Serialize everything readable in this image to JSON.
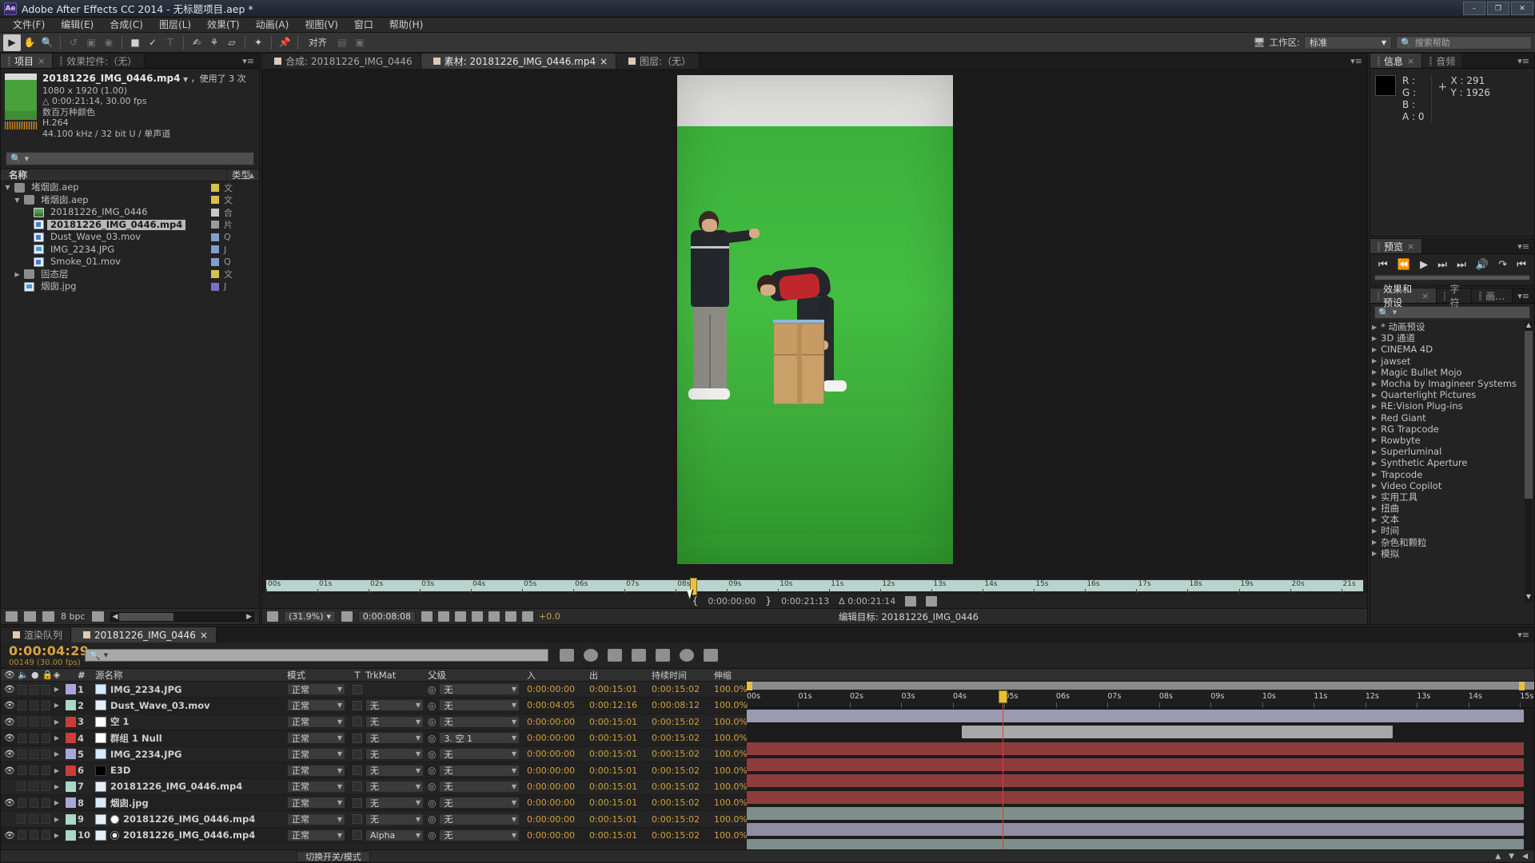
{
  "titlebar": {
    "logo": "Ae",
    "title": "Adobe After Effects CC 2014 - 无标题项目.aep *",
    "min": "–",
    "max": "❐",
    "close": "✕"
  },
  "menubar": {
    "items": [
      "文件(F)",
      "编辑(E)",
      "合成(C)",
      "图层(L)",
      "效果(T)",
      "动画(A)",
      "视图(V)",
      "窗口",
      "帮助(H)"
    ]
  },
  "toolbar": {
    "align_label": "对齐",
    "workspace_label": "工作区:",
    "workspace_value": "标准",
    "search_placeholder": "搜索帮助"
  },
  "project": {
    "tabs": [
      {
        "label": "项目",
        "active": true,
        "closable": true
      },
      {
        "label": "效果控件:（无）",
        "active": false,
        "closable": false
      }
    ],
    "selected_item": {
      "name": "20181226_IMG_0446.mp4",
      "used": "，使用了 3 次",
      "dimensions": "1080 x 1920 (1.00)",
      "duration": "0:00:21:14, 30.00 fps",
      "colors": "数百万种颜色",
      "codec": "H.264",
      "audio": "44.100 kHz / 32 bit U / 单声道"
    },
    "search_placeholder": "",
    "columns": {
      "name": "名称",
      "type": "类型"
    },
    "items": [
      {
        "label": "堵烟囱.aep",
        "suffix": "",
        "indent": 0,
        "icon": "folder-icon",
        "twirl": "▼",
        "swatch": "#d6c24a",
        "type": "文件夹",
        "selected": false
      },
      {
        "label": "堵烟囱.aep",
        "suffix": "",
        "indent": 1,
        "icon": "folder-icon",
        "twirl": "▼",
        "swatch": "#d6c24a",
        "type": "文件夹",
        "selected": false
      },
      {
        "label": "20181226_IMG_0446",
        "suffix": "",
        "indent": 2,
        "icon": "comp-icon",
        "twirl": "",
        "swatch": "#c8c8c8",
        "type": "合成",
        "selected": false
      },
      {
        "label": "20181226_IMG_0446.mp4",
        "suffix": "",
        "indent": 2,
        "icon": "mov-icon",
        "twirl": "",
        "swatch": "#9a9a9a",
        "type": "片段",
        "selected": true
      },
      {
        "label": "Dust_Wave_03.mov",
        "suffix": "",
        "indent": 2,
        "icon": "mov-icon",
        "twirl": "",
        "swatch": "#7f9fd0",
        "type": "Quic",
        "selected": false
      },
      {
        "label": "IMG_2234.JPG",
        "suffix": "",
        "indent": 2,
        "icon": "jpg-icon",
        "twirl": "",
        "swatch": "#7f9fd0",
        "type": "JPEG",
        "selected": false
      },
      {
        "label": "Smoke_01.mov",
        "suffix": "",
        "indent": 2,
        "icon": "mov-icon",
        "twirl": "",
        "swatch": "#7f9fd0",
        "type": "Quic",
        "selected": false
      },
      {
        "label": "固态层",
        "suffix": "",
        "indent": 1,
        "icon": "folder-icon",
        "twirl": "▶",
        "swatch": "#d6c24a",
        "type": "文件夹",
        "selected": false
      },
      {
        "label": "烟囱.jpg",
        "suffix": "",
        "indent": 1,
        "icon": "jpg-icon",
        "twirl": "",
        "swatch": "#7f6fc0",
        "type": "JPEG",
        "selected": false
      }
    ],
    "footer": {
      "bpc": "8 bpc"
    }
  },
  "viewer": {
    "tabs": [
      {
        "label": "合成: 20181226_IMG_0446",
        "active": false
      },
      {
        "label": "素材: 20181226_IMG_0446.mp4",
        "active": true
      },
      {
        "label": "图层:（无）",
        "active": false
      }
    ],
    "ruler_ticks": [
      "00s",
      "01s",
      "02s",
      "03s",
      "04s",
      "05s",
      "06s",
      "07s",
      "08s",
      "09s",
      "10s",
      "11s",
      "12s",
      "13s",
      "14s",
      "15s",
      "16s",
      "17s",
      "18s",
      "19s",
      "20s",
      "21s"
    ],
    "playhead_seconds": 8.27,
    "in_point": "0:00:00:00",
    "out_point": "0:00:21:13",
    "duration_delta": "Δ 0:00:21:14",
    "zoom": "(31.9%)",
    "current_time": "0:00:08:08",
    "exposure": "+0.0",
    "edit_target_label": "编辑目标:",
    "edit_target_value": "20181226_IMG_0446"
  },
  "info": {
    "tabs": [
      {
        "label": "信息",
        "active": true
      },
      {
        "label": "音频",
        "active": false
      }
    ],
    "r": "R :",
    "g": "G :",
    "b": "B :",
    "a": "A : 0",
    "x": "X : 291",
    "y": "Y : 1926"
  },
  "preview": {
    "tabs": [
      {
        "label": "预览",
        "active": true
      }
    ],
    "buttons": [
      "first-frame",
      "prev-frame",
      "play",
      "next-frame",
      "last-frame",
      "mute",
      "loop",
      "ram-preview"
    ]
  },
  "effects": {
    "tabs": [
      {
        "label": "效果和预设",
        "active": true
      },
      {
        "label": "字符",
        "active": false
      },
      {
        "label": "画…",
        "active": false
      }
    ],
    "search_placeholder": "",
    "items": [
      "* 动画预设",
      "3D 通道",
      "CINEMA 4D",
      "jawset",
      "Magic Bullet Mojo",
      "Mocha by Imagineer Systems",
      "Quarterlight Pictures",
      "RE:Vision Plug-ins",
      "Red Giant",
      "RG Trapcode",
      "Rowbyte",
      "Superluminal",
      "Synthetic Aperture",
      "Trapcode",
      "Video Copilot",
      "实用工具",
      "扭曲",
      "文本",
      "时间",
      "杂色和颗粒",
      "模拟"
    ]
  },
  "timeline": {
    "tabs": [
      {
        "label": "渲染队列",
        "active": false
      },
      {
        "label": "20181226_IMG_0446",
        "active": true
      }
    ],
    "current_time": "0:00:04:29",
    "frame_info": "00149 (30.00 fps)",
    "search_placeholder": "",
    "columns": {
      "num": "#",
      "source": "源名称",
      "mode": "模式",
      "t": "T",
      "trkmat": "TrkMat",
      "parent": "父级",
      "in": "入",
      "out": "出",
      "duration": "持续时间",
      "stretch": "伸缩"
    },
    "layers": [
      {
        "num": "1",
        "name": "IMG_2234.JPG",
        "icon": "jpg-icon",
        "swatch": "#a9a6d8",
        "visible": true,
        "mode": "正常",
        "trkmat": "",
        "parent": "无",
        "in": "0:00:00:00",
        "out": "0:00:15:01",
        "dur": "0:00:15:02",
        "stretch": "100.0%",
        "bar": {
          "start": 0,
          "end": 15.07,
          "color": "#9a9ab0"
        }
      },
      {
        "num": "2",
        "name": "Dust_Wave_03.mov",
        "icon": "mov-icon",
        "swatch": "#a9d8c8",
        "visible": true,
        "mode": "正常",
        "trkmat": "无",
        "parent": "无",
        "in": "0:00:04:05",
        "out": "0:00:12:16",
        "dur": "0:00:08:12",
        "stretch": "100.0%",
        "bar": {
          "start": 4.17,
          "end": 12.53,
          "color": "#a8a8a8"
        }
      },
      {
        "num": "3",
        "name": "空 1",
        "icon": "white-solid",
        "swatch": "#cf3b3b",
        "visible": true,
        "mode": "正常",
        "trkmat": "无",
        "parent": "无",
        "in": "0:00:00:00",
        "out": "0:00:15:01",
        "dur": "0:00:15:02",
        "stretch": "100.0%",
        "bar": {
          "start": 0,
          "end": 15.07,
          "color": "#8e3c3c"
        }
      },
      {
        "num": "4",
        "name": "群组 1 Null",
        "icon": "white-solid",
        "swatch": "#cf3b3b",
        "visible": true,
        "mode": "正常",
        "trkmat": "无",
        "parent": "3. 空 1",
        "in": "0:00:00:00",
        "out": "0:00:15:01",
        "dur": "0:00:15:02",
        "stretch": "100.0%",
        "bar": {
          "start": 0,
          "end": 15.07,
          "color": "#8e3c3c"
        }
      },
      {
        "num": "5",
        "name": "IMG_2234.JPG",
        "icon": "jpg-icon",
        "swatch": "#a9a6d8",
        "visible": true,
        "mode": "正常",
        "trkmat": "无",
        "parent": "无",
        "in": "0:00:00:00",
        "out": "0:00:15:01",
        "dur": "0:00:15:02",
        "stretch": "100.0%",
        "bar": {
          "start": 0,
          "end": 15.07,
          "color": "#8e3c3c"
        }
      },
      {
        "num": "6",
        "name": "E3D",
        "icon": "black-solid",
        "swatch": "#cf3b3b",
        "visible": true,
        "mode": "正常",
        "trkmat": "无",
        "parent": "无",
        "in": "0:00:00:00",
        "out": "0:00:15:01",
        "dur": "0:00:15:02",
        "stretch": "100.0%",
        "bar": {
          "start": 0,
          "end": 15.07,
          "color": "#8e3c3c"
        }
      },
      {
        "num": "7",
        "name": "20181226_IMG_0446.mp4",
        "icon": "mov-icon",
        "swatch": "#a9d8c8",
        "visible": false,
        "mode": "正常",
        "trkmat": "无",
        "parent": "无",
        "in": "0:00:00:00",
        "out": "0:00:15:01",
        "dur": "0:00:15:02",
        "stretch": "100.0%",
        "bar": {
          "start": 0,
          "end": 15.07,
          "color": "#7e8e8a"
        }
      },
      {
        "num": "8",
        "name": "烟囱.jpg",
        "icon": "jpg-icon",
        "swatch": "#a9a6d8",
        "visible": true,
        "mode": "正常",
        "trkmat": "无",
        "parent": "无",
        "in": "0:00:00:00",
        "out": "0:00:15:01",
        "dur": "0:00:15:02",
        "stretch": "100.0%",
        "bar": {
          "start": 0,
          "end": 15.07,
          "color": "#8e8ea0"
        }
      },
      {
        "num": "9",
        "name": "20181226_IMG_0446.mp4",
        "icon": "mov-icon",
        "swatch": "#a9d8c8",
        "visible": false,
        "matte": "dot",
        "mode": "正常",
        "trkmat": "无",
        "parent": "无",
        "in": "0:00:00:00",
        "out": "0:00:15:01",
        "dur": "0:00:15:02",
        "stretch": "100.0%",
        "bar": {
          "start": 0,
          "end": 15.07,
          "color": "#7e8e8a"
        }
      },
      {
        "num": "10",
        "name": "20181226_IMG_0446.mp4",
        "icon": "mov-icon",
        "swatch": "#a9d8c8",
        "visible": true,
        "matte": "star",
        "mode": "正常",
        "trkmat": "Alpha",
        "parent": "无",
        "in": "0:00:00:00",
        "out": "0:00:15:01",
        "dur": "0:00:15:02",
        "stretch": "100.0%",
        "bar": {
          "start": 0,
          "end": 15.07,
          "color": "#7e8e8a"
        }
      }
    ],
    "ruler_ticks": [
      "00s",
      "01s",
      "02s",
      "03s",
      "04s",
      "05s",
      "06s",
      "07s",
      "08s",
      "09s",
      "10s",
      "11s",
      "12s",
      "13s",
      "14s",
      "15s"
    ],
    "playhead_seconds": 4.97,
    "toggle_label": "切换开关/模式"
  }
}
